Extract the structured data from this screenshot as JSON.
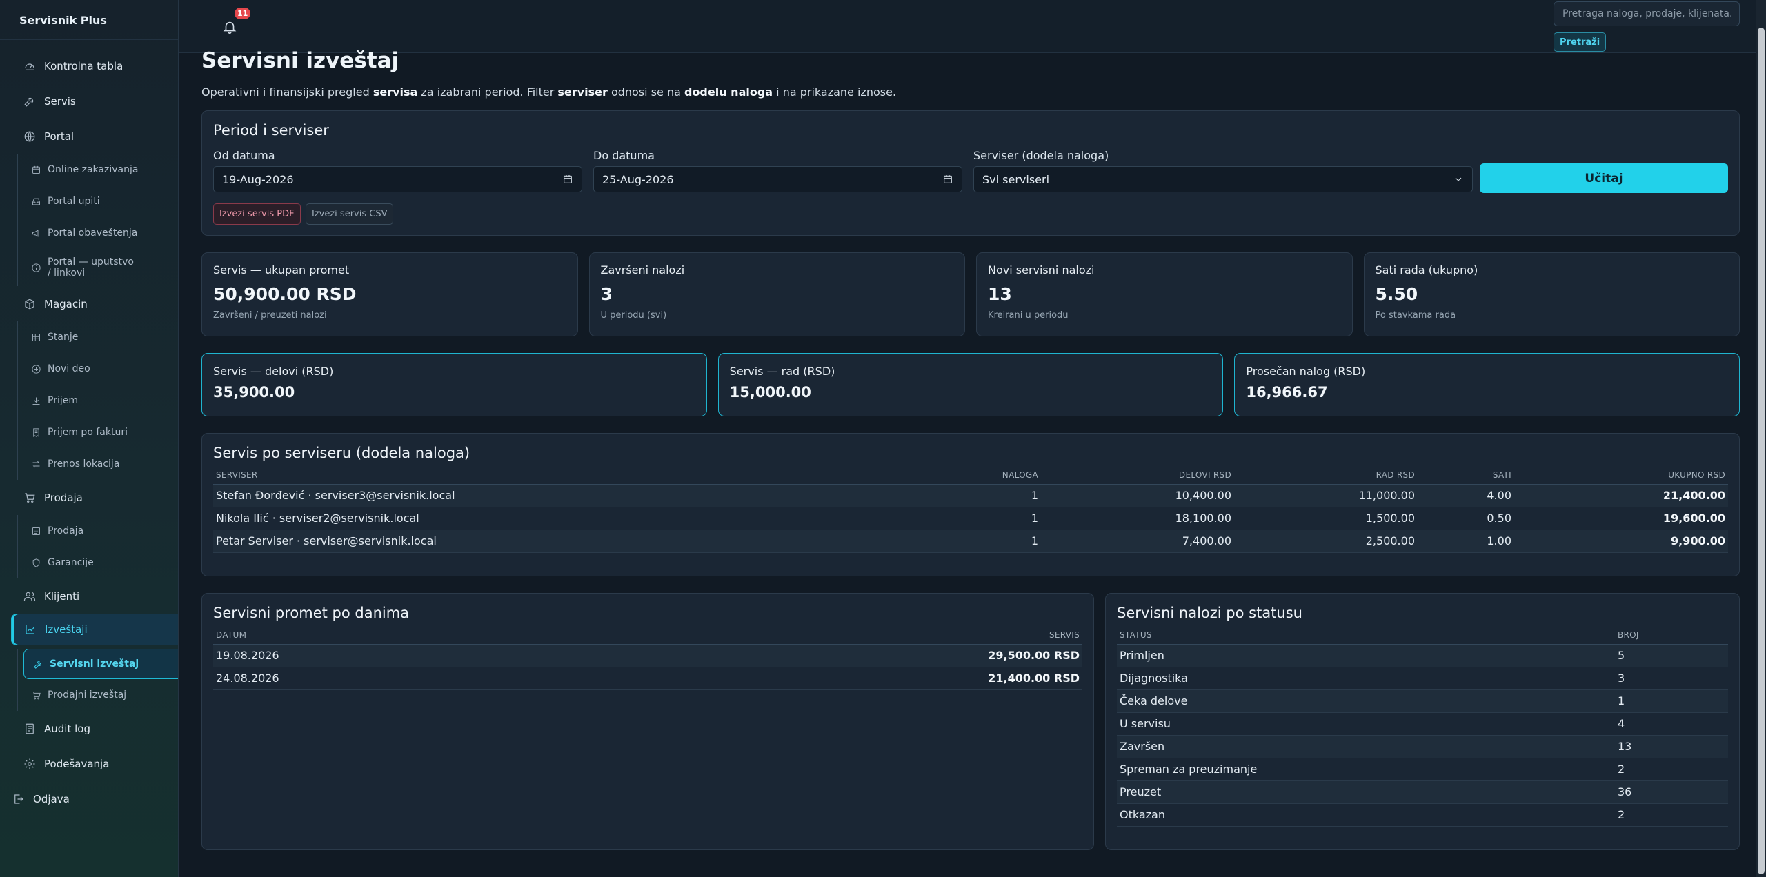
{
  "brand": "Servisnik Plus",
  "nav": {
    "dashboard": "Kontrolna tabla",
    "servis": "Servis",
    "portal": "Portal",
    "portal_sub": [
      "Online zakazivanja",
      "Portal upiti",
      "Portal obaveštenja",
      "Portal — uputstvo / linkovi"
    ],
    "magacin": "Magacin",
    "magacin_sub": [
      "Stanje",
      "Novi deo",
      "Prijem",
      "Prijem po fakturi",
      "Prenos lokacija"
    ],
    "prodaja": "Prodaja",
    "prodaja_sub": [
      "Prodaja",
      "Garancije"
    ],
    "klijenti": "Klijenti",
    "izvestaji": "Izveštaji",
    "izvestaji_sub": [
      "Servisni izveštaj",
      "Prodajni izveštaj"
    ],
    "audit": "Audit log",
    "settings": "Podešavanja",
    "logout": "Odjava"
  },
  "topbar": {
    "notifications_count": "11",
    "search_placeholder": "Pretraga naloga, prodaje, klijenata...",
    "search_button": "Pretraži"
  },
  "page": {
    "title": "Servisni izveštaj",
    "subtitle_parts": [
      "Operativni i finansijski pregled ",
      "servisa",
      " za izabrani period. Filter ",
      "serviser",
      " odnosi se na ",
      "dodelu naloga",
      " i na prikazane iznose."
    ]
  },
  "filter": {
    "title": "Period i serviser",
    "from_label": "Od datuma",
    "from_value": "19-Aug-2026",
    "to_label": "Do datuma",
    "to_value": "25-Aug-2026",
    "serviser_label": "Serviser (dodela naloga)",
    "serviser_value": "Svi serviseri",
    "load_button": "Učitaj",
    "export_pdf": "Izvezi servis PDF",
    "export_csv": "Izvezi servis CSV"
  },
  "stats": [
    {
      "title": "Servis — ukupan promet",
      "value": "50,900.00 RSD",
      "sub": "Završeni / preuzeti nalozi"
    },
    {
      "title": "Završeni nalozi",
      "value": "3",
      "sub": "U periodu (svi)"
    },
    {
      "title": "Novi servisni nalozi",
      "value": "13",
      "sub": "Kreirani u periodu"
    },
    {
      "title": "Sati rada (ukupno)",
      "value": "5.50",
      "sub": "Po stavkama rada"
    }
  ],
  "stats2": [
    {
      "title": "Servis — delovi (RSD)",
      "value": "35,900.00"
    },
    {
      "title": "Servis — rad (RSD)",
      "value": "15,000.00"
    },
    {
      "title": "Prosečan nalog (RSD)",
      "value": "16,966.67"
    }
  ],
  "by_serviser": {
    "title": "Servis po serviseru (dodela naloga)",
    "columns": [
      "Serviser",
      "Naloga",
      "Delovi RSD",
      "Rad RSD",
      "Sati",
      "Ukupno RSD"
    ],
    "rows": [
      [
        "Stefan Đorđević · serviser3@servisnik.local",
        "1",
        "10,400.00",
        "11,000.00",
        "4.00",
        "21,400.00"
      ],
      [
        "Nikola Ilić · serviser2@servisnik.local",
        "1",
        "18,100.00",
        "1,500.00",
        "0.50",
        "19,600.00"
      ],
      [
        "Petar Serviser · serviser@servisnik.local",
        "1",
        "7,400.00",
        "2,500.00",
        "1.00",
        "9,900.00"
      ]
    ]
  },
  "by_day": {
    "title": "Servisni promet po danima",
    "columns": [
      "Datum",
      "Servis"
    ],
    "rows": [
      [
        "19.08.2026",
        "29,500.00 RSD"
      ],
      [
        "24.08.2026",
        "21,400.00 RSD"
      ]
    ]
  },
  "by_status": {
    "title": "Servisni nalozi po statusu",
    "columns": [
      "Status",
      "Broj"
    ],
    "rows": [
      [
        "Primljen",
        "5"
      ],
      [
        "Dijagnostika",
        "3"
      ],
      [
        "Čeka delove",
        "1"
      ],
      [
        "U servisu",
        "4"
      ],
      [
        "Završen",
        "13"
      ],
      [
        "Spreman za preuzimanje",
        "2"
      ],
      [
        "Preuzet",
        "36"
      ],
      [
        "Otkazan",
        "2"
      ]
    ]
  },
  "colors": {
    "accent": "#22d1ea",
    "badge": "#e5484d",
    "background": "#111a24"
  }
}
